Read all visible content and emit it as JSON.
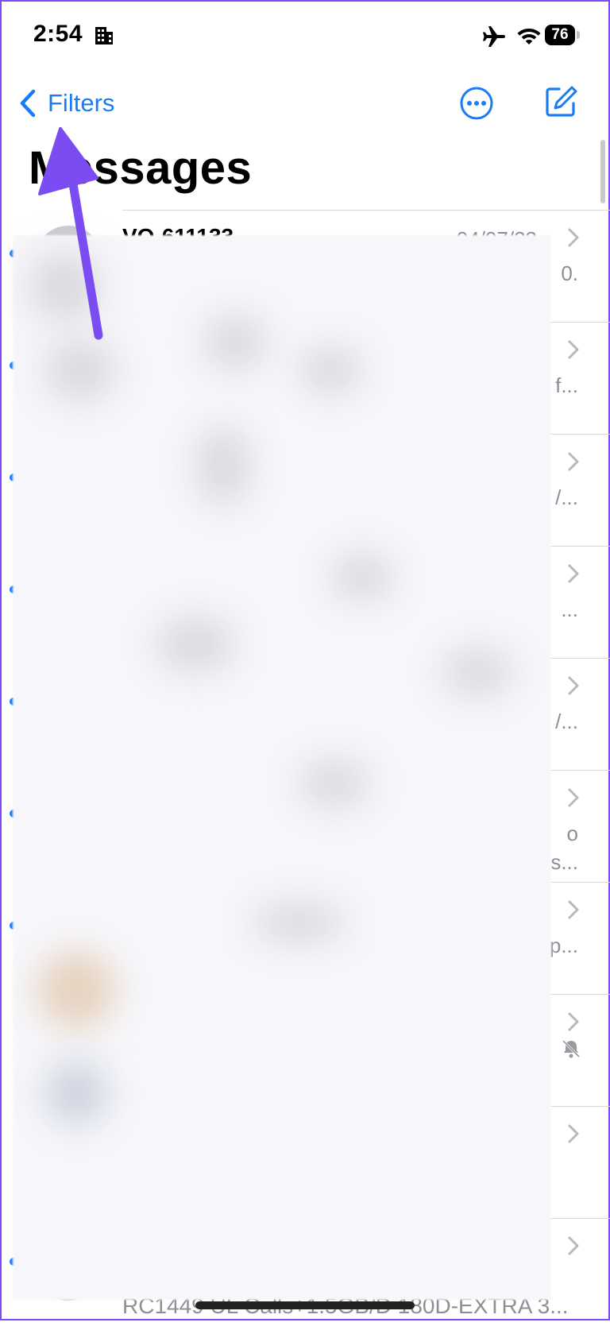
{
  "status_bar": {
    "time": "2:54",
    "battery": "76"
  },
  "nav": {
    "back_label": "Filters",
    "more_icon": "ellipsis-circle-icon",
    "compose_icon": "compose-icon"
  },
  "page_title": "Messages",
  "rows": [
    {
      "sender": "VO-611133",
      "date": "04/07/23",
      "preview": "0.",
      "unread": true
    },
    {
      "sender": "",
      "date": "",
      "preview": "f...",
      "unread": true
    },
    {
      "sender": "",
      "date": "",
      "preview": "/...",
      "unread": true
    },
    {
      "sender": "",
      "date": "",
      "preview": "...",
      "unread": true
    },
    {
      "sender": "",
      "date": "",
      "preview": "/...",
      "unread": true
    },
    {
      "sender": "",
      "date": "",
      "preview": "o\ns...",
      "unread": true
    },
    {
      "sender": "",
      "date": "",
      "preview": "p...",
      "unread": true
    },
    {
      "sender": "",
      "date": "",
      "preview": "",
      "unread": false,
      "muted": true
    },
    {
      "sender": "",
      "date": "",
      "preview": "",
      "unread": false
    },
    {
      "sender": "",
      "date": "",
      "preview": "",
      "unread": true
    }
  ],
  "bottom_preview": "RC1449 UL Calls+1.5GB/D 180D-EXTRA 3...",
  "colors": {
    "accent": "#1a7cf5",
    "annotation": "#7b4cf2"
  }
}
